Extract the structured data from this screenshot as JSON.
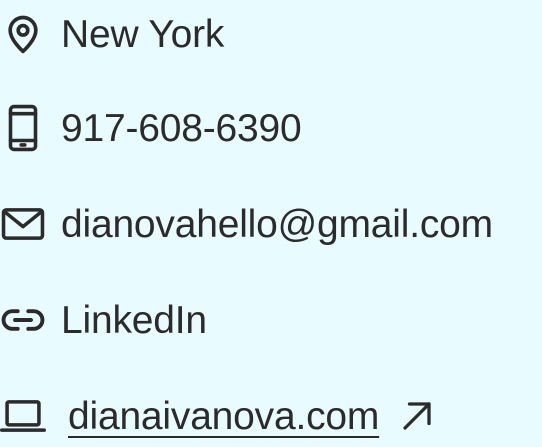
{
  "contacts": {
    "location": {
      "icon": "map-pin-icon",
      "label": "New York"
    },
    "phone": {
      "icon": "smartphone-icon",
      "label": "917-608-6390"
    },
    "email": {
      "icon": "mail-icon",
      "label": "dianovahello@gmail.com"
    },
    "linkedin": {
      "icon": "link-icon",
      "label": "LinkedIn"
    },
    "website": {
      "icon": "laptop-icon",
      "label": "dianaivanova.com",
      "external_icon": "arrow-up-right-icon"
    }
  },
  "colors": {
    "background": "#e8fbff",
    "text": "#2b2b2b"
  }
}
